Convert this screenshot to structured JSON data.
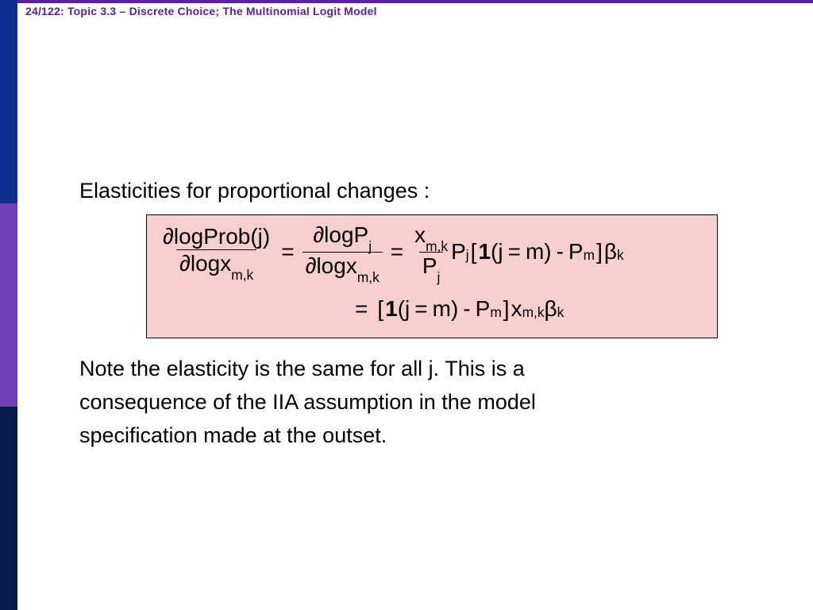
{
  "header": {
    "title": "24/122: Topic 3.3 – Discrete Choice; The Multinomial Logit Model"
  },
  "content": {
    "lead": "Elasticities for proportional changes :",
    "eq": {
      "d": "∂",
      "logProbJ": "logProb(j)",
      "logx": "logx",
      "sub_mk": "m,k",
      "logP": "logP",
      "sub_j": "j",
      "x": "x",
      "P": "P",
      "equals": "=",
      "lbracket": "[",
      "rbracket": "]",
      "one": "1",
      "lparen": "(",
      "rparen": ")",
      "jeqm": "j",
      "eqsign_inner": "=",
      "m": "m",
      "minus": "-",
      "beta": "β",
      "sub_k": "k",
      "sub_m": "m",
      "space": " "
    },
    "note_line1": "Note the elasticity is the same for all j.  This is a",
    "note_line2": "consequence of the IIA assumption in the model",
    "note_line3": "specification made at the outset."
  },
  "colors": {
    "accent_purple": "#5a1f9e",
    "sidebar_top": "#0f2f8f",
    "sidebar_middle": "#6f3fb5",
    "sidebar_bottom": "#061b4a",
    "equation_bg": "#f8cfd1"
  }
}
